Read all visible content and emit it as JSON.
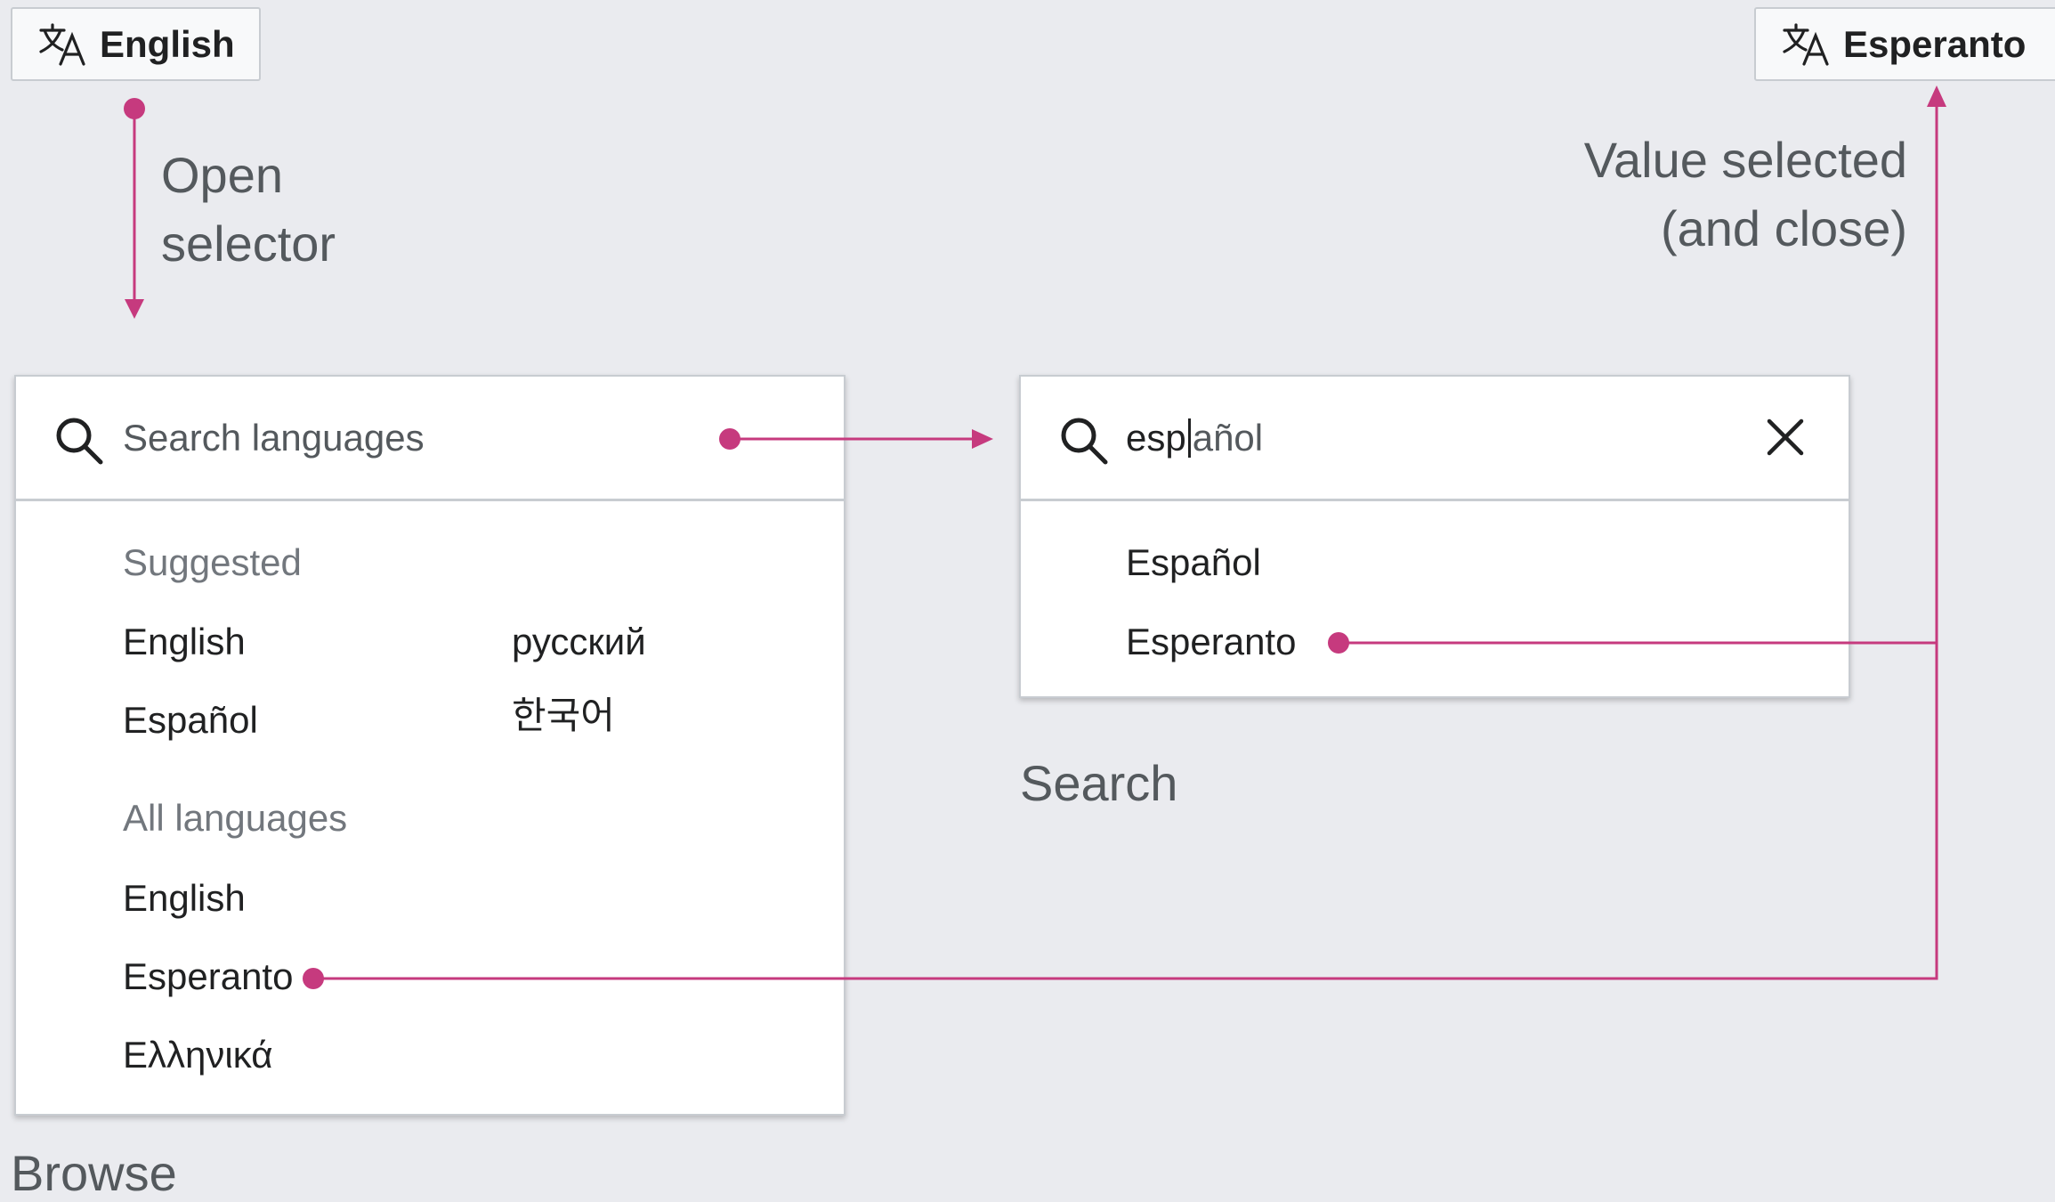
{
  "buttons": {
    "initial": {
      "label": "English",
      "icon": "translate-icon"
    },
    "final": {
      "label": "Esperanto",
      "icon": "translate-icon"
    }
  },
  "annotations": {
    "open_line1": "Open",
    "open_line2": "selector",
    "selected_line1": "Value selected",
    "selected_line2": "(and close)"
  },
  "browse": {
    "search_placeholder": "Search languages",
    "suggested_heading": "Suggested",
    "suggested": [
      "English",
      "русский",
      "Español",
      "한국어"
    ],
    "all_heading": "All languages",
    "all": [
      "English",
      "Esperanto",
      "Ελληνικά"
    ],
    "label": "Browse"
  },
  "search": {
    "query_typed": "esp",
    "query_rest": "añol",
    "results": [
      "Español",
      "Esperanto"
    ],
    "label": "Search"
  },
  "colors": {
    "accent": "#c63a7e",
    "background": "#eaebef",
    "panel_border": "#c8ccd1"
  }
}
